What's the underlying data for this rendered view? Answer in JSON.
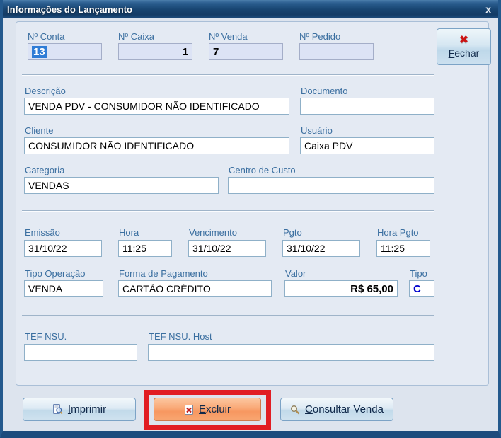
{
  "window": {
    "title": "Informações do Lançamento",
    "close_glyph": "x"
  },
  "fields": {
    "conta": {
      "label": "Nº Conta",
      "value": "13"
    },
    "caixa": {
      "label": "Nº Caixa",
      "value": "1"
    },
    "venda": {
      "label": "Nº Venda",
      "value": "7"
    },
    "pedido": {
      "label": "Nº Pedido",
      "value": ""
    },
    "descricao": {
      "label": "Descrição",
      "value": "VENDA PDV - CONSUMIDOR NÃO IDENTIFICADO"
    },
    "documento": {
      "label": "Documento",
      "value": ""
    },
    "cliente": {
      "label": "Cliente",
      "value": "CONSUMIDOR NÃO IDENTIFICADO"
    },
    "usuario": {
      "label": "Usuário",
      "value": "Caixa PDV"
    },
    "categoria": {
      "label": "Categoria",
      "value": "VENDAS"
    },
    "centro_custo": {
      "label": "Centro de Custo",
      "value": ""
    },
    "emissao": {
      "label": "Emissão",
      "value": "31/10/22"
    },
    "hora": {
      "label": "Hora",
      "value": "11:25"
    },
    "vencimento": {
      "label": "Vencimento",
      "value": "31/10/22"
    },
    "pgto": {
      "label": "Pgto",
      "value": "31/10/22"
    },
    "hora_pgto": {
      "label": "Hora Pgto",
      "value": "11:25"
    },
    "tipo_operacao": {
      "label": "Tipo Operação",
      "value": "VENDA"
    },
    "forma_pagamento": {
      "label": "Forma de Pagamento",
      "value": "CARTÃO CRÉDITO"
    },
    "valor": {
      "label": "Valor",
      "value": "R$ 65,00"
    },
    "tipo": {
      "label": "Tipo",
      "value": "C"
    },
    "tef_nsu": {
      "label": "TEF NSU.",
      "value": ""
    },
    "tef_nsu_host": {
      "label": "TEF NSU. Host",
      "value": ""
    }
  },
  "buttons": {
    "fechar": "Fechar",
    "imprimir": "Imprimir",
    "excluir": "Excluir",
    "consultar_venda": "Consultar Venda"
  },
  "icons": {
    "titlebar_close": "close-x",
    "fechar": "red-x",
    "imprimir": "print-preview-magnifier-page",
    "excluir": "delete-document-red-x",
    "consultar_venda": "magnifier"
  },
  "colors": {
    "titlebar": "#17436f",
    "label_blue": "#3b6fa0",
    "selection_blue": "#2f7cd6",
    "tipo_value_blue": "#0000cc",
    "excluir_orange": "#f79760",
    "annotation_red": "#e11d23"
  }
}
